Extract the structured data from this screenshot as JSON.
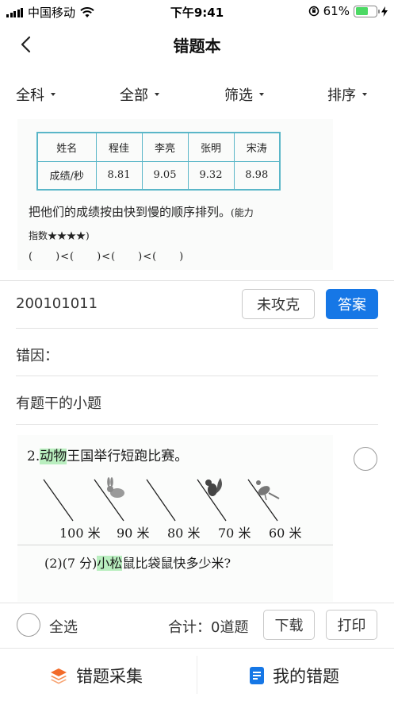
{
  "status_bar": {
    "carrier": "中国移动",
    "time": "下午9:41",
    "battery_percent": "61%",
    "battery_level": 0.61
  },
  "nav": {
    "title": "错题本"
  },
  "filters": [
    {
      "label": "全科"
    },
    {
      "label": "全部"
    },
    {
      "label": "筛选"
    },
    {
      "label": "排序"
    }
  ],
  "question1": {
    "table_header": [
      "姓名",
      "程佳",
      "李亮",
      "张明",
      "宋涛"
    ],
    "table_row": [
      "成绩/秒",
      "8.81",
      "9.05",
      "9.32",
      "8.98"
    ],
    "prompt": "把他们的成绩按由快到慢的顺序排列。",
    "ability_prefix": "(能力",
    "ability_suffix": "指数★★★★)",
    "blanks": "(　　)<(　　)<(　　)<(　　)"
  },
  "record": {
    "id": "200101011",
    "status_button": "未攻克",
    "answer_button": "答案",
    "reason_label": "错因：",
    "type_label": "有题干的小题"
  },
  "question2": {
    "number": "2.",
    "highlight1": "动物",
    "title_rest": "王国举行短跑比赛。",
    "distances": [
      "100 米",
      "90 米",
      "80 米",
      "70 米",
      "60 米"
    ],
    "sub_prefix": "(2)(7 分)",
    "highlight2": "小松",
    "sub_rest": "鼠比袋鼠快多少米?"
  },
  "action_bar": {
    "select_all": "全选",
    "total_label": "合计：",
    "total_value": "0道题",
    "download": "下载",
    "print": "打印"
  },
  "tabs": [
    {
      "label": "错题采集",
      "icon": "layers-icon"
    },
    {
      "label": "我的错题",
      "icon": "document-icon"
    }
  ],
  "colors": {
    "primary": "#1677e6",
    "highlight": "#b9eebf",
    "table_border": "#5ab6c8",
    "collect_icon": "#f26b2a"
  }
}
